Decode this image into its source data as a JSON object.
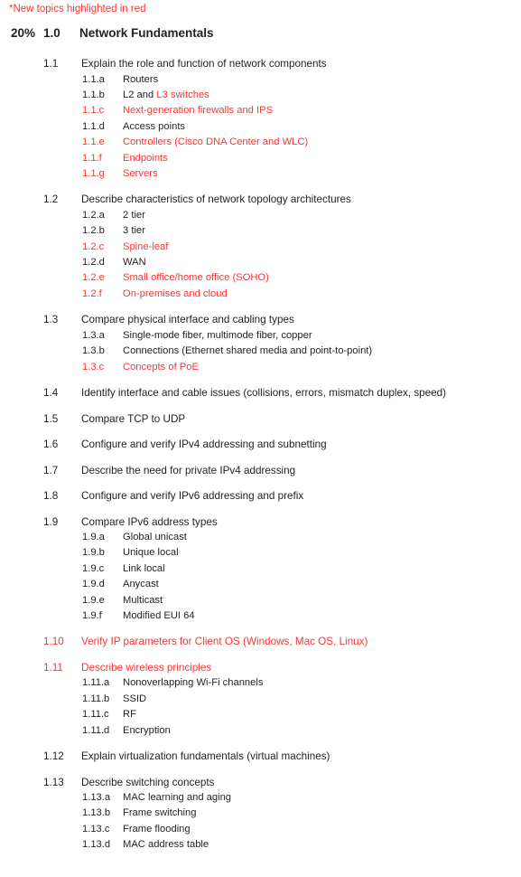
{
  "note": "*New topics highlighted in red",
  "colors": {
    "new_topic_red": "#ff3333",
    "body_black": "#231f20",
    "background": "#ffffff"
  },
  "domain": {
    "percent": "20%",
    "number": "1.0",
    "title": "Network Fundamentals",
    "is_new": false
  },
  "topics": [
    {
      "number": "1.1",
      "text": "Explain the role and function of network components",
      "is_new": false,
      "subs": [
        {
          "number": "1.1.a",
          "text": "Routers",
          "is_new": false
        },
        {
          "number": "1.1.b",
          "text": " L2 and ",
          "text_red": "L3 switches",
          "is_new": false,
          "mixed": true
        },
        {
          "number": "1.1.c",
          "text": "Next-generation firewalls and IPS",
          "is_new": true
        },
        {
          "number": "1.1.d",
          "text": "Access points",
          "is_new": false
        },
        {
          "number": "1.1.e",
          "text": "Controllers (Cisco DNA Center and WLC)",
          "is_new": true
        },
        {
          "number": "1.1.f",
          "text": "Endpoints",
          "is_new": true
        },
        {
          "number": "1.1.g",
          "text": "Servers",
          "is_new": true
        }
      ]
    },
    {
      "number": "1.2",
      "text": "Describe characteristics of network topology architectures",
      "is_new": false,
      "subs": [
        {
          "number": "1.2.a",
          "text": "2 tier",
          "is_new": false
        },
        {
          "number": "1.2.b",
          "text": "3 tier",
          "is_new": false
        },
        {
          "number": "1.2.c",
          "text": "Spine-leaf",
          "is_new": true
        },
        {
          "number": "1.2.d",
          "text": "WAN",
          "is_new": false
        },
        {
          "number": "1.2.e",
          "text": "Small office/home office (SOHO)",
          "is_new": true
        },
        {
          "number": "1.2.f",
          "text": "On-premises and cloud",
          "is_new": true
        }
      ]
    },
    {
      "number": "1.3",
      "text": "Compare physical interface and cabling types",
      "is_new": false,
      "subs": [
        {
          "number": "1.3.a",
          "text": "Single-mode fiber, multimode fiber, copper",
          "is_new": false
        },
        {
          "number": "1.3.b",
          "text": "Connections (Ethernet shared media and point-to-point)",
          "is_new": false
        },
        {
          "number": "1.3.c",
          "text": "Concepts of PoE",
          "is_new": true
        }
      ]
    },
    {
      "number": "1.4",
      "text": "Identify interface and cable issues (collisions, errors, mismatch duplex, speed)",
      "is_new": false,
      "subs": []
    },
    {
      "number": "1.5",
      "text": "Compare TCP to UDP",
      "is_new": false,
      "subs": []
    },
    {
      "number": "1.6",
      "text": "Configure and verify IPv4 addressing and subnetting",
      "is_new": false,
      "subs": []
    },
    {
      "number": "1.7",
      "text": "Describe the need for private IPv4 addressing",
      "is_new": false,
      "subs": []
    },
    {
      "number": "1.8",
      "text": "Configure and verify IPv6 addressing and prefix",
      "is_new": false,
      "subs": []
    },
    {
      "number": "1.9",
      "text": "Compare IPv6 address types",
      "is_new": false,
      "subs": [
        {
          "number": "1.9.a",
          "text": "Global unicast",
          "is_new": false
        },
        {
          "number": "1.9.b",
          "text": "Unique local",
          "is_new": false
        },
        {
          "number": "1.9.c",
          "text": "Link local",
          "is_new": false
        },
        {
          "number": "1.9.d",
          "text": "Anycast",
          "is_new": false
        },
        {
          "number": "1.9.e",
          "text": "Multicast",
          "is_new": false
        },
        {
          "number": "1.9.f",
          "text": "Modified EUI 64",
          "is_new": false
        }
      ]
    },
    {
      "number": "1.10",
      "text": "Verify IP parameters for Client OS (Windows, Mac OS, Linux)",
      "is_new": true,
      "subs": []
    },
    {
      "number": "1.11",
      "text": "Describe wireless principles",
      "is_new": true,
      "subs": [
        {
          "number": "1.11.a",
          "text": "Nonoverlapping Wi-Fi channels",
          "is_new": false
        },
        {
          "number": "1.11.b",
          "text": "SSID",
          "is_new": false
        },
        {
          "number": "1.11.c",
          "text": "RF",
          "is_new": false
        },
        {
          "number": "1.11.d",
          "text": "Encryption",
          "is_new": false
        }
      ]
    },
    {
      "number": "1.12",
      "text": "Explain virtualization fundamentals (virtual machines)",
      "is_new": false,
      "subs": []
    },
    {
      "number": "1.13",
      "text": "Describe switching concepts",
      "is_new": false,
      "subs": [
        {
          "number": "1.13.a",
          "text": "MAC learning and aging",
          "is_new": false
        },
        {
          "number": "1.13.b",
          "text": "Frame switching",
          "is_new": false
        },
        {
          "number": "1.13.c",
          "text": "Frame flooding",
          "is_new": false
        },
        {
          "number": "1.13.d",
          "text": "MAC address table",
          "is_new": false
        }
      ]
    }
  ]
}
